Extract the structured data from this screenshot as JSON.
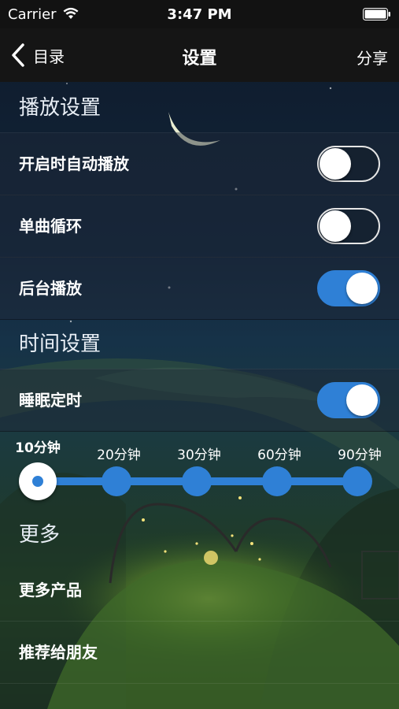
{
  "status_bar": {
    "carrier": "Carrier",
    "time": "3:47 PM",
    "icons": [
      "wifi-icon",
      "battery-icon"
    ]
  },
  "nav": {
    "back_label": "目录",
    "title": "设置",
    "share_label": "分享",
    "back_icon": "chevron-left-icon"
  },
  "sections": {
    "playback": {
      "header": "播放设置",
      "items": [
        {
          "label": "开启时自动播放",
          "on": false
        },
        {
          "label": "单曲循环",
          "on": false
        },
        {
          "label": "后台播放",
          "on": true
        }
      ]
    },
    "time": {
      "header": "时间设置",
      "sleep_timer": {
        "label": "睡眠定时",
        "on": true
      },
      "timer_options": [
        "10分钟",
        "20分钟",
        "30分钟",
        "60分钟",
        "90分钟"
      ],
      "selected_option": "10分钟"
    },
    "more": {
      "header": "更多",
      "items": [
        {
          "label": "更多产品"
        },
        {
          "label": "推荐给朋友"
        }
      ]
    }
  },
  "colors": {
    "accent": "#2f80d6",
    "nav_background": "#151515",
    "status_bar_background": "#121212"
  }
}
